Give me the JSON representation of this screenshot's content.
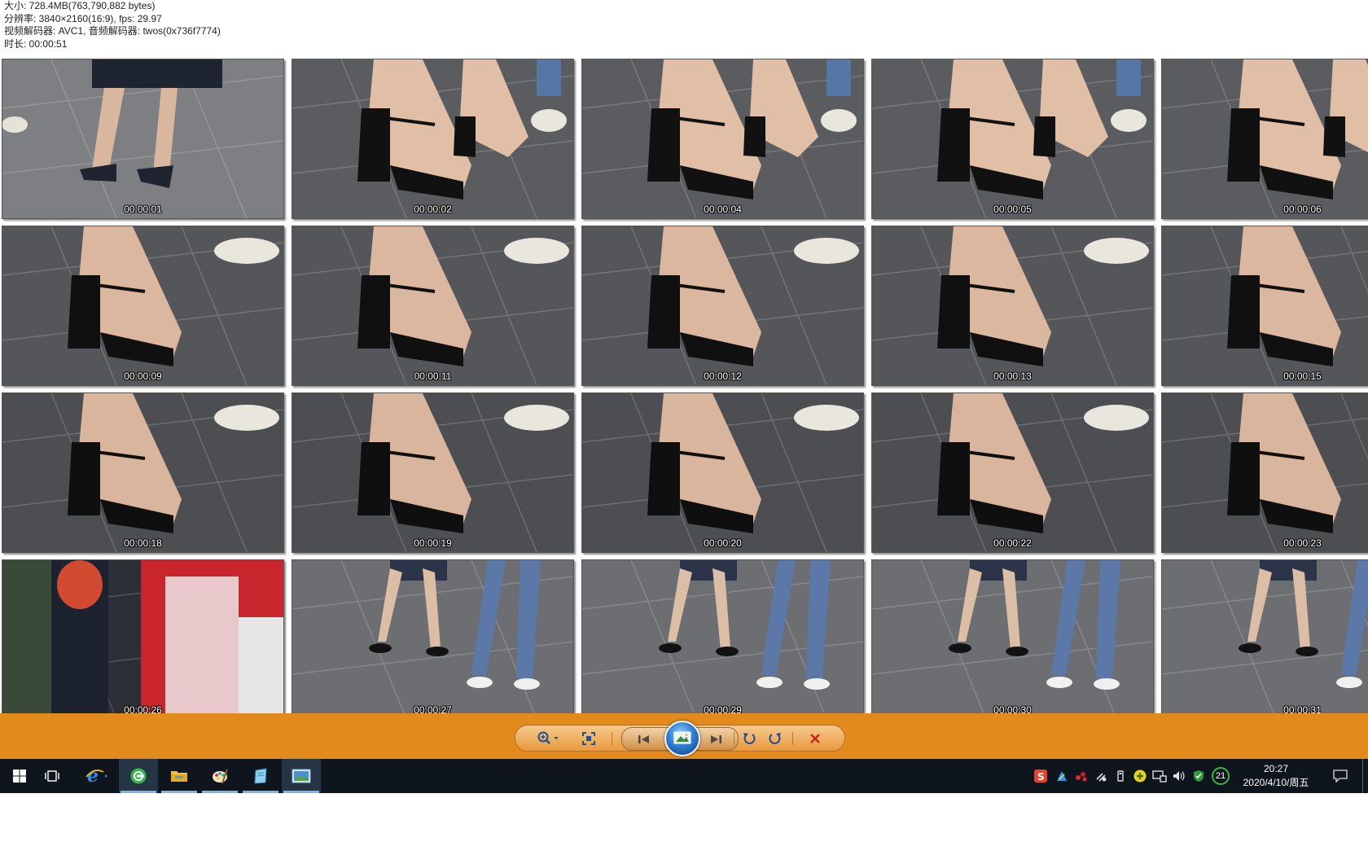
{
  "info": {
    "size_line": "大小: 728.4MB(763,790,882 bytes)",
    "resolution_line": "分辨率: 3840×2160(16:9), fps: 29.97",
    "codec_line": "视频解码器: AVC1, 音频解码器: twos(0x736f7774)",
    "duration_line": "时长: 00:00:51"
  },
  "thumbnails": [
    {
      "time": "00:00:01",
      "scene": "legs-skirt"
    },
    {
      "time": "00:00:02",
      "scene": "sandals-pair"
    },
    {
      "time": "00:00:04",
      "scene": "sandals-pair"
    },
    {
      "time": "00:00:05",
      "scene": "sandals-pair"
    },
    {
      "time": "00:00:06",
      "scene": "sandals-pair"
    },
    {
      "time": "00:00:09",
      "scene": "sandal-close"
    },
    {
      "time": "00:00:11",
      "scene": "sandal-close"
    },
    {
      "time": "00:00:12",
      "scene": "sandal-close"
    },
    {
      "time": "00:00:13",
      "scene": "sandal-close"
    },
    {
      "time": "00:00:15",
      "scene": "sandal-close"
    },
    {
      "time": "00:00:18",
      "scene": "sandal-side"
    },
    {
      "time": "00:00:19",
      "scene": "sandal-side"
    },
    {
      "time": "00:00:20",
      "scene": "sandal-side"
    },
    {
      "time": "00:00:22",
      "scene": "sandal-side"
    },
    {
      "time": "00:00:23",
      "scene": "sandal-side"
    },
    {
      "time": "00:00:26",
      "scene": "crowd-store"
    },
    {
      "time": "00:00:27",
      "scene": "walking-pair"
    },
    {
      "time": "00:00:29",
      "scene": "walking-pair"
    },
    {
      "time": "00:00:30",
      "scene": "walking-pair"
    },
    {
      "time": "00:00:31",
      "scene": "walking-pair"
    }
  ],
  "toolbar": {
    "buttons": [
      {
        "name": "zoom-button",
        "icon": "magnifier-icon"
      },
      {
        "name": "actual-size-button",
        "icon": "fit-window-icon"
      },
      {
        "name": "previous-button",
        "icon": "skip-previous-icon"
      },
      {
        "name": "slideshow-button",
        "icon": "slideshow-icon"
      },
      {
        "name": "next-button",
        "icon": "skip-next-icon"
      },
      {
        "name": "rotate-left-button",
        "icon": "rotate-ccw-icon"
      },
      {
        "name": "rotate-right-button",
        "icon": "rotate-cw-icon"
      },
      {
        "name": "delete-button",
        "icon": "delete-x-icon"
      }
    ]
  },
  "taskbar": {
    "apps": [
      "start-icon",
      "task-view-icon",
      "ie-icon",
      "browser-360-icon",
      "file-explorer-icon",
      "paint-icon",
      "notepad-icon",
      "photo-viewer-icon"
    ],
    "tray": [
      "sogou-ime-icon",
      "tray-app-icon",
      "tray-dots-icon",
      "network-icon",
      "usb-icon",
      "add-icon",
      "lan-icon",
      "volume-icon",
      "security-shield-icon"
    ],
    "badge_count": "21",
    "time": "20:27",
    "date": "2020/4/10/周五"
  },
  "colors": {
    "toolbar_bg": "#e38a1c",
    "taskbar_bg": "#0f151c",
    "accent": "#2f7fd4",
    "delete": "#d0221c"
  }
}
